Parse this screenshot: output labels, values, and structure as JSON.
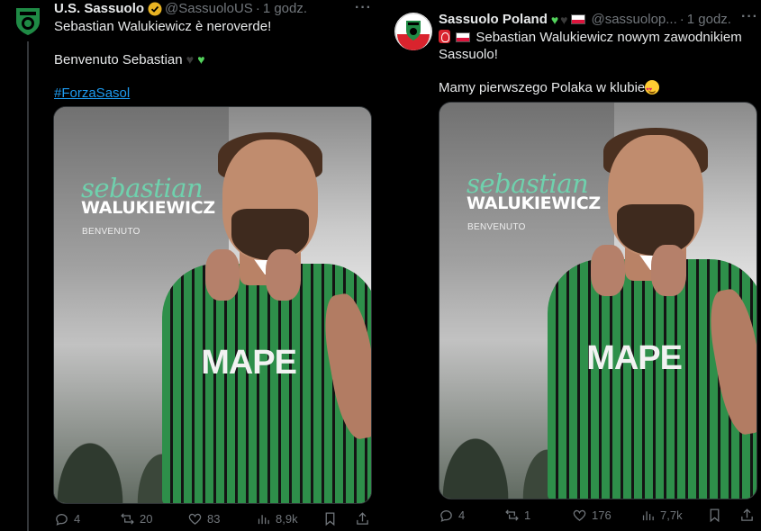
{
  "left_tweet": {
    "author_name": "U.S. Sassuolo",
    "handle": "@SassuoloUS",
    "separator": "·",
    "time": "1 godz.",
    "more": "···",
    "line1": "Sebastian Walukiewicz è neroverde!",
    "line2": "Benvenuto Sebastian",
    "hashtag": "#ForzaSasol",
    "media": {
      "name_script": "sebastian",
      "name_caps": "WALUKIEWICZ",
      "subtitle": "BENVENUTO",
      "sponsor": "MAPE"
    },
    "stats": {
      "replies": "4",
      "reposts": "20",
      "likes": "83",
      "views": "8,9k"
    }
  },
  "right_tweet": {
    "author_name": "Sassuolo Poland",
    "handle": "@sassuolop...",
    "separator": "·",
    "time": "1 godz.",
    "more": "···",
    "line1": "Sebastian Walukiewicz nowym zawodnikiem",
    "line1b": "Sassuolo!",
    "line2": "Mamy pierwszego Polaka w klubie",
    "media": {
      "name_script": "sebastian",
      "name_caps": "WALUKIEWICZ",
      "subtitle": "BENVENUTO",
      "sponsor": "MAPE"
    },
    "stats": {
      "replies": "4",
      "reposts": "1",
      "likes": "176",
      "views": "7,7k"
    }
  },
  "colors": {
    "accent": "#1d9bf0",
    "green": "#2e8f4a",
    "muted": "#71767b",
    "script_green": "#6fd1ad"
  }
}
